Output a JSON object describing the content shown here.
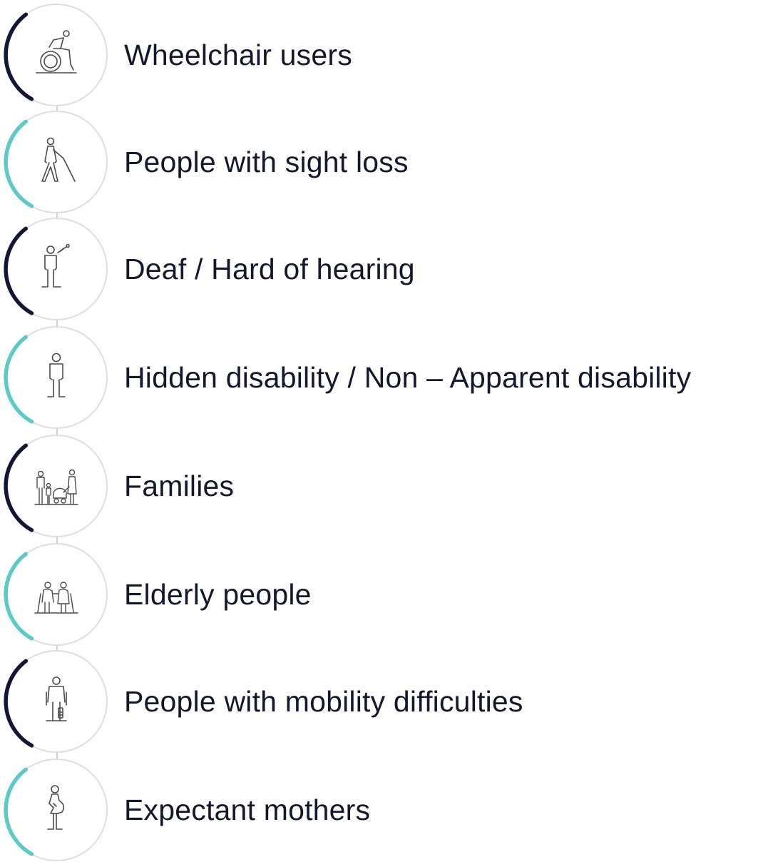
{
  "colors": {
    "navy": "#141638",
    "teal": "#5ccac7",
    "ring": "#dedede",
    "connector": "#cfcfcf",
    "icon_stroke": "#4a4a4a",
    "text": "#15172c"
  },
  "items": [
    {
      "label": "Wheelchair users",
      "icon": "wheelchair-user-icon",
      "accent": "navy"
    },
    {
      "label": "People with sight loss",
      "icon": "person-with-white-cane-icon",
      "accent": "teal"
    },
    {
      "label": "Deaf / Hard of hearing",
      "icon": "person-with-hearing-aid-icon",
      "accent": "navy"
    },
    {
      "label": "Hidden disability / Non – Apparent disability",
      "icon": "standing-person-icon",
      "accent": "teal"
    },
    {
      "label": "Families",
      "icon": "family-with-pram-icon",
      "accent": "navy"
    },
    {
      "label": "Elderly people",
      "icon": "elderly-couple-icon",
      "accent": "teal"
    },
    {
      "label": "People with mobility difficulties",
      "icon": "person-with-crutches-icon",
      "accent": "navy"
    },
    {
      "label": "Expectant mothers",
      "icon": "pregnant-woman-icon",
      "accent": "teal"
    }
  ]
}
